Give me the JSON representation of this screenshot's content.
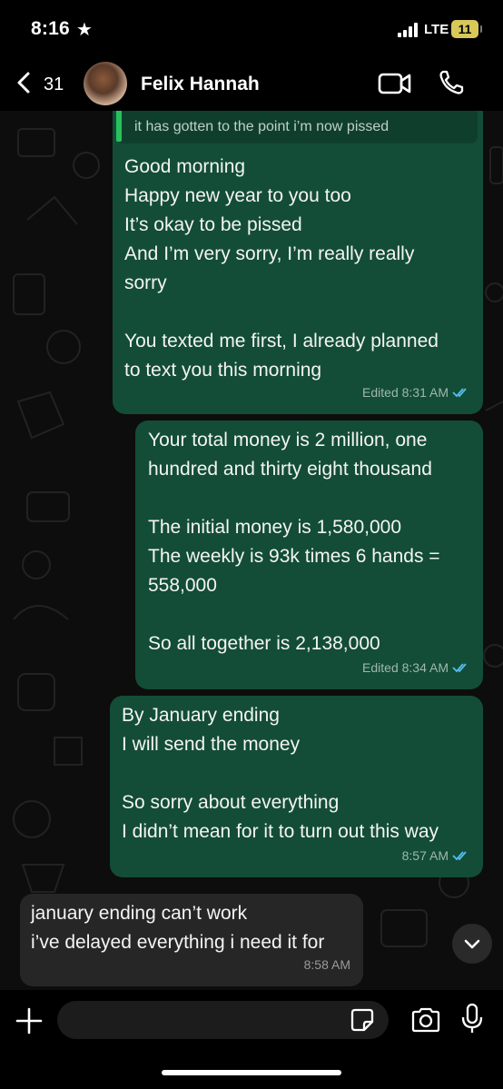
{
  "status_bar": {
    "time": "8:16",
    "network": "LTE",
    "battery": "11"
  },
  "header": {
    "back_count": "31",
    "contact_name": "Felix Hannah"
  },
  "messages": [
    {
      "direction": "outgoing",
      "quoted_text": "it has gotten to the point i’m now pissed",
      "text": "Good morning\nHappy new year to you too\nIt’s okay to be pissed\nAnd I’m very sorry, I’m really really\nsorry\n\nYou texted me first, I already planned\nto text you this morning",
      "time": "Edited 8:31 AM",
      "read": true
    },
    {
      "direction": "outgoing",
      "text": "Your total money is 2 million, one\nhundred and thirty eight thousand\n\nThe initial money is 1,580,000\nThe weekly is 93k times 6 hands =\n558,000\n\nSo all together is 2,138,000",
      "time": "Edited 8:34 AM",
      "read": true
    },
    {
      "direction": "outgoing",
      "text": "By January ending\nI will send the money\n\nSo sorry about everything\nI didn’t mean for it to turn out this way",
      "time": "8:57 AM",
      "read": true
    },
    {
      "direction": "incoming",
      "text": "january ending can’t work\ni’ve delayed everything i need it for",
      "time": "8:58 AM"
    }
  ],
  "composer": {
    "placeholder": "",
    "value": ""
  },
  "colors": {
    "outgoing_bubble": "#134d37",
    "incoming_bubble": "#262626",
    "read_ticks": "#53bdeb",
    "reply_bar": "#27c25e"
  },
  "icons": [
    "star-icon",
    "signal-icon",
    "battery-icon",
    "back-chevron-icon",
    "video-call-icon",
    "phone-call-icon",
    "chevron-down-icon",
    "plus-icon",
    "sticker-icon",
    "camera-icon",
    "microphone-icon",
    "double-check-icon"
  ]
}
